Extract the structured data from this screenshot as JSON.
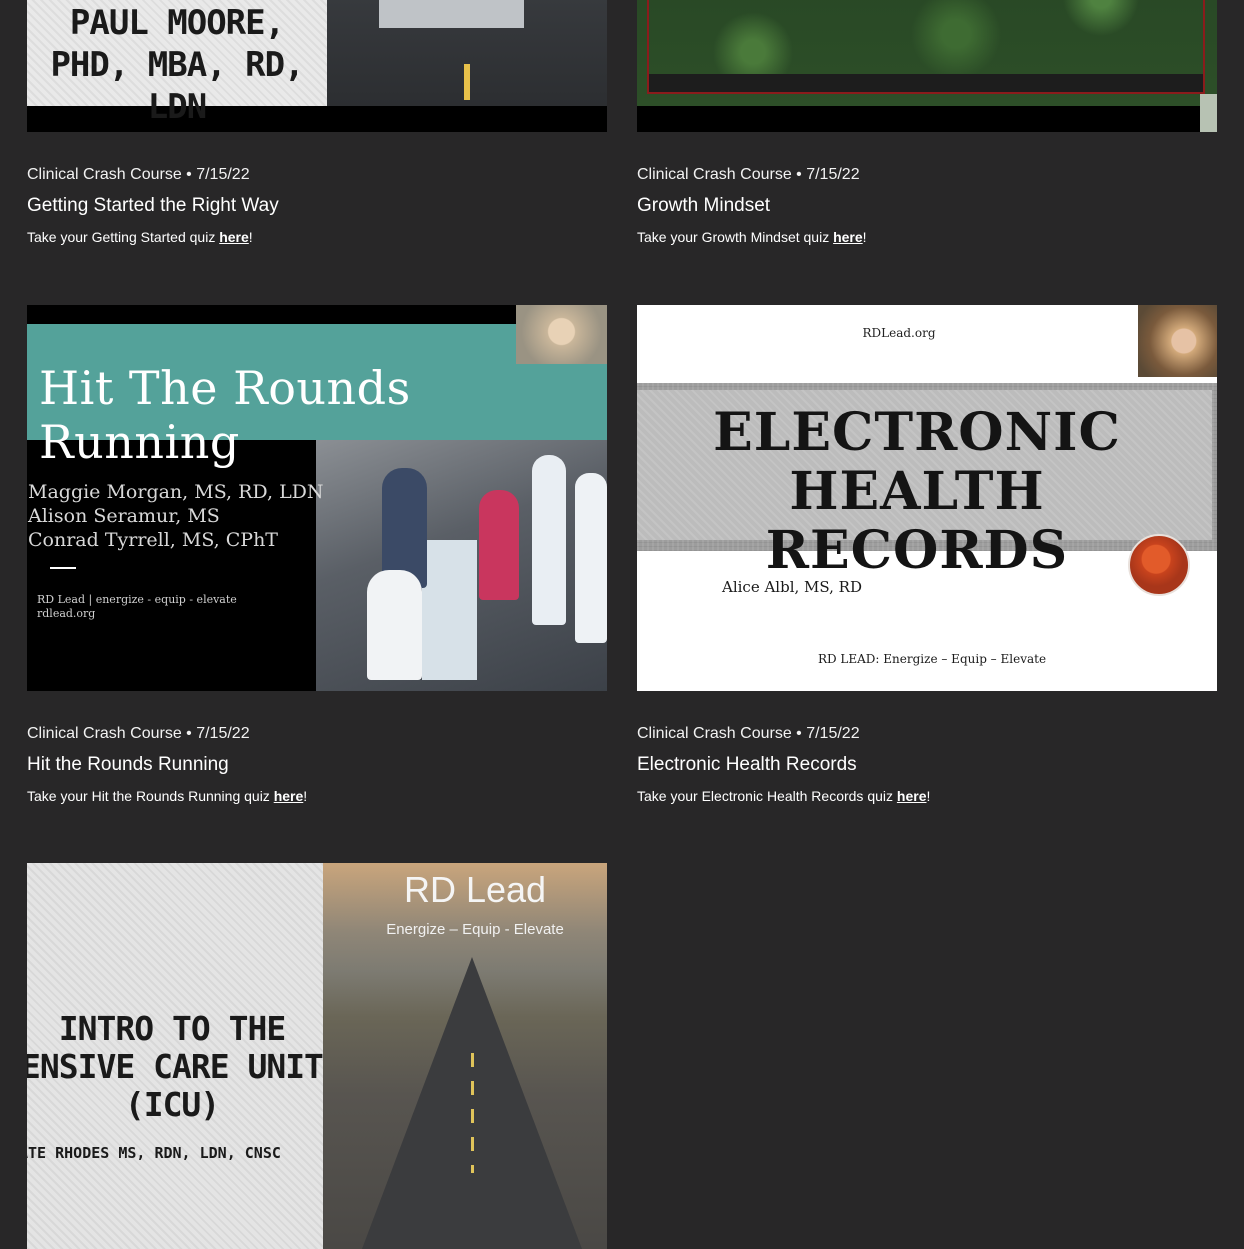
{
  "cards": [
    {
      "meta": "Clinical Crash Course • 7/15/22",
      "title": "Getting Started the Right Way",
      "desc_prefix": "Take your Getting Started quiz ",
      "link": "here",
      "desc_suffix": "!",
      "thumb_text": "PAUL MOORE, PHD, MBA, RD, LDN"
    },
    {
      "meta": "Clinical Crash Course • 7/15/22",
      "title": "Growth Mindset",
      "desc_prefix": "Take your Growth Mindset quiz ",
      "link": "here",
      "desc_suffix": "!"
    },
    {
      "meta": "Clinical Crash Course • 7/15/22",
      "title": "Hit the Rounds Running",
      "desc_prefix": "Take your Hit the Rounds Running quiz ",
      "link": "here",
      "desc_suffix": "!",
      "thumb_title": "Hit The Rounds Running",
      "thumb_names": [
        "Maggie Morgan, MS, RD, LDN",
        "Alison Seramur, MS",
        "Conrad Tyrrell, MS, CPhT"
      ],
      "thumb_foot": [
        "RD Lead | energize - equip - elevate",
        "rdlead.org"
      ]
    },
    {
      "meta": "Clinical Crash Course • 7/15/22",
      "title": "Electronic Health Records",
      "desc_prefix": "Take your Electronic Health Records quiz ",
      "link": "here",
      "desc_suffix": "!",
      "thumb_top": "RDLead.org",
      "thumb_title": [
        "ELECTRONIC",
        "HEALTH RECORDS"
      ],
      "thumb_author": "Alice Albl, MS, RD",
      "thumb_foot": "RD LEAD:  Energize – Equip – Elevate"
    },
    {
      "thumb_title": [
        "INTRO TO THE",
        "ENSIVE CARE UNIT",
        "(ICU)"
      ],
      "thumb_sub": "ATE RHODES MS, RDN, LDN, CNSC",
      "thumb_brand": "RD Lead",
      "thumb_tag": "Energize – Equip - Elevate"
    }
  ]
}
